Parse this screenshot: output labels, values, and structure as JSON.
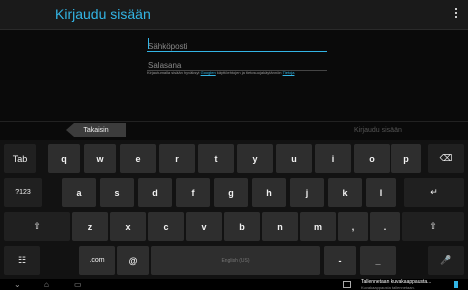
{
  "app": {
    "title": "Kirjaudu sisään"
  },
  "form": {
    "email_placeholder": "Sähköposti",
    "password_placeholder": "Salasana",
    "terms_before": "Kirjautumalla sisään hyväksyt ",
    "terms_link1": "Googlen",
    "terms_middle": " käyttöehtojen ja tietosuojakäytännön",
    "terms_link2": "Tietoja",
    "terms_after": ""
  },
  "buttons": {
    "back": "Takaisin",
    "login": "Kirjaudu sisään"
  },
  "keyboard": {
    "row1": [
      "Tab",
      "q",
      "w",
      "e",
      "r",
      "t",
      "y",
      "u",
      "i",
      "o",
      "p",
      "⌫"
    ],
    "row2": [
      "?123",
      "a",
      "s",
      "d",
      "f",
      "g",
      "h",
      "j",
      "k",
      "l",
      "↵"
    ],
    "row3": [
      "⇧",
      "z",
      "x",
      "c",
      "v",
      "b",
      "n",
      "m",
      ",",
      ".",
      "⇧"
    ],
    "row4": [
      "☷",
      ".com",
      "@",
      "English (US)",
      "-",
      "_",
      "🎤"
    ]
  },
  "notification": {
    "title": "Tallennetaan kuvakaappausta...",
    "subtitle": "Kuvakaappausta tallennetaan."
  },
  "colors": {
    "accent": "#33b5e5",
    "key": "#2e2e2e",
    "background": "#0a0a0a"
  }
}
